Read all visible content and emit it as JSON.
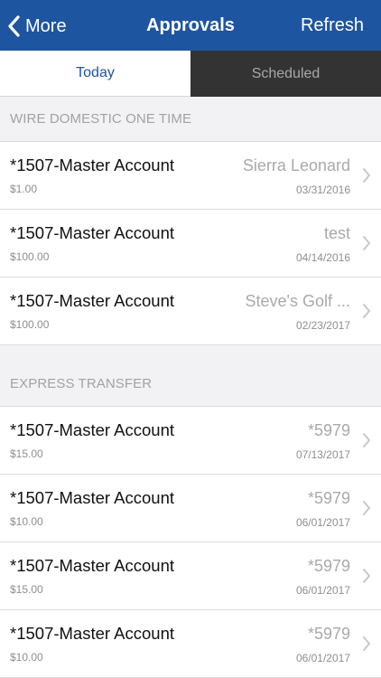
{
  "navbar": {
    "back_label": "More",
    "title": "Approvals",
    "refresh_label": "Refresh"
  },
  "tabs": [
    {
      "label": "Today",
      "active": true
    },
    {
      "label": "Scheduled",
      "active": false
    }
  ],
  "sections": [
    {
      "title": "WIRE DOMESTIC ONE TIME",
      "items": [
        {
          "account": "*1507-Master Account",
          "amount": "$1.00",
          "name": "Sierra Leonard",
          "date": "03/31/2016"
        },
        {
          "account": "*1507-Master Account",
          "amount": "$100.00",
          "name": "test",
          "date": "04/14/2016"
        },
        {
          "account": "*1507-Master Account",
          "amount": "$100.00",
          "name": "Steve's Golf ...",
          "date": "02/23/2017"
        }
      ]
    },
    {
      "title": "EXPRESS TRANSFER",
      "items": [
        {
          "account": "*1507-Master Account",
          "amount": "$15.00",
          "name": "*5979",
          "date": "07/13/2017"
        },
        {
          "account": "*1507-Master Account",
          "amount": "$10.00",
          "name": "*5979",
          "date": "06/01/2017"
        },
        {
          "account": "*1507-Master Account",
          "amount": "$15.00",
          "name": "*5979",
          "date": "06/01/2017"
        },
        {
          "account": "*1507-Master Account",
          "amount": "$10.00",
          "name": "*5979",
          "date": "06/01/2017"
        }
      ]
    }
  ],
  "colors": {
    "navbar": "#1e55a0",
    "tab_active_text": "#1e55a0",
    "tab_inactive_bg": "#333333",
    "background": "#f2f2f4"
  },
  "icons": {
    "back": "chevron-left-icon",
    "row": "chevron-right-icon"
  }
}
